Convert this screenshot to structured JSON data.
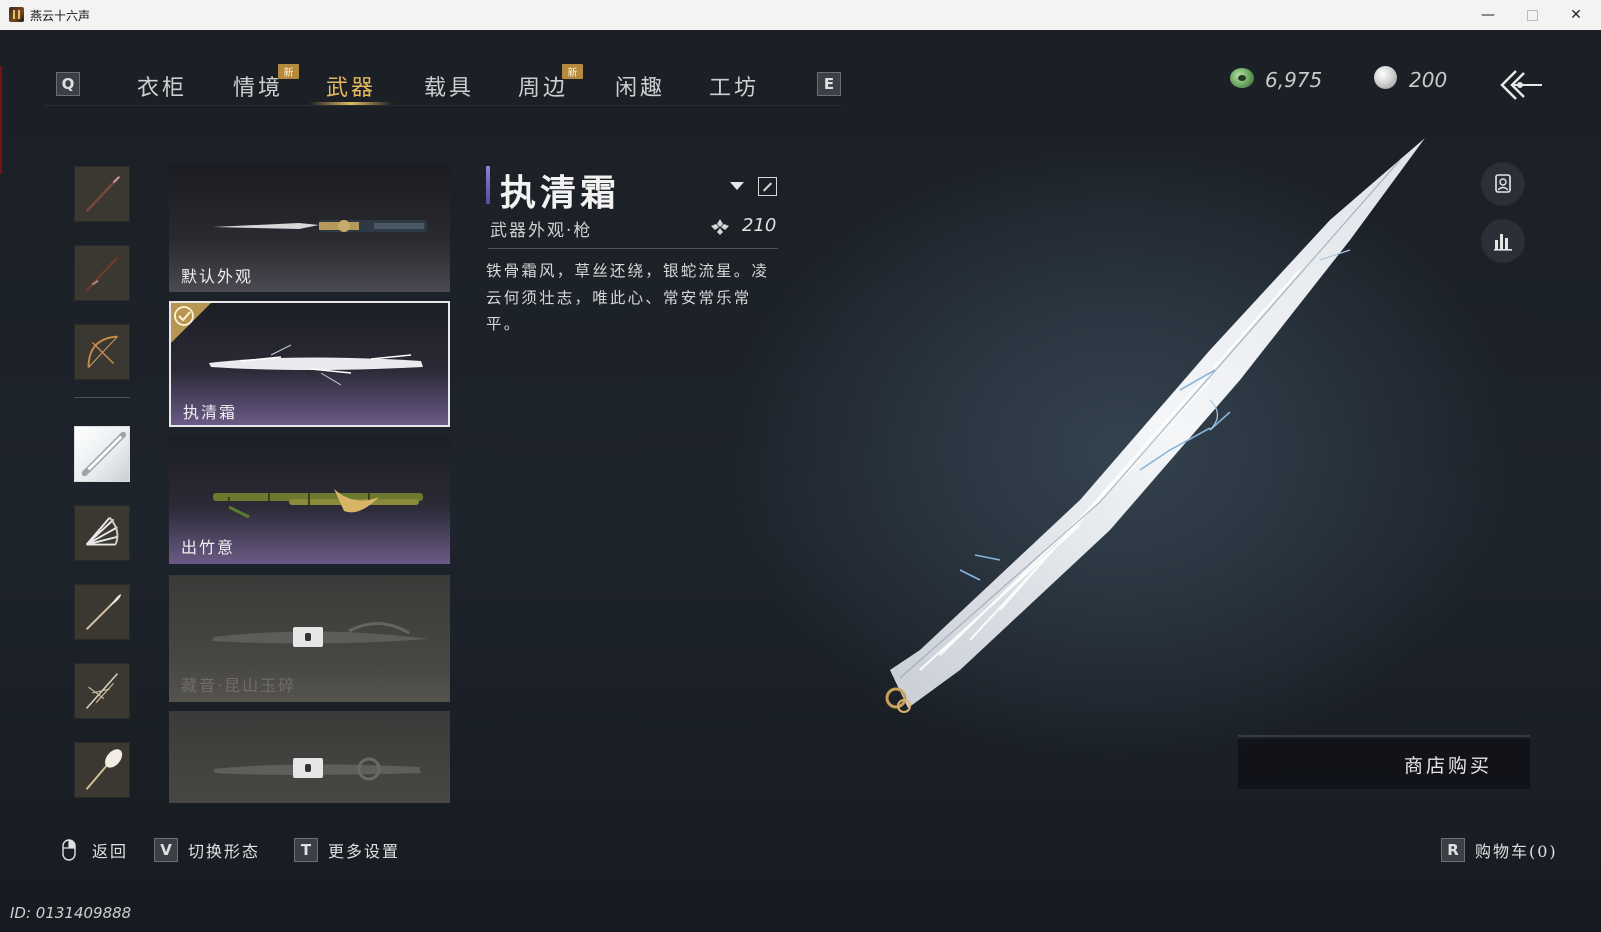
{
  "window": {
    "title": "燕云十六声"
  },
  "tabs": {
    "prev_key": "Q",
    "next_key": "E",
    "new_badge": "新",
    "items": [
      {
        "label": "衣柜",
        "active": false,
        "new": false
      },
      {
        "label": "情境",
        "active": false,
        "new": true
      },
      {
        "label": "武器",
        "active": true,
        "new": false
      },
      {
        "label": "载具",
        "active": false,
        "new": false
      },
      {
        "label": "周边",
        "active": false,
        "new": true
      },
      {
        "label": "闲趣",
        "active": false,
        "new": false
      },
      {
        "label": "工坊",
        "active": false,
        "new": false
      }
    ]
  },
  "currency": {
    "jade": "6,975",
    "pearl": "200"
  },
  "category_icons": [
    {
      "name": "spear-icon-1",
      "selected": false
    },
    {
      "name": "spear-icon-2",
      "selected": false
    },
    {
      "name": "bow-icon",
      "selected": false
    },
    {
      "name": "white-spear-icon",
      "selected": true
    },
    {
      "name": "fan-icon",
      "selected": false
    },
    {
      "name": "brush-icon",
      "selected": false
    },
    {
      "name": "umbrella-frame-icon",
      "selected": false
    },
    {
      "name": "whisk-icon",
      "selected": false
    }
  ],
  "weapon_cards": [
    {
      "label": "默认外观",
      "selected": false,
      "locked": false
    },
    {
      "label": "执清霜",
      "selected": true,
      "locked": false
    },
    {
      "label": "出竹意",
      "selected": false,
      "locked": false
    },
    {
      "label": "藏音·昆山玉碎",
      "selected": false,
      "locked": true
    },
    {
      "label": "",
      "selected": false,
      "locked": true
    }
  ],
  "detail": {
    "title": "执清霜",
    "subtitle": "武器外观·枪",
    "price": "210",
    "description": "铁骨霜风，草丝还绕，银蛇流星。凌云何须壮志，唯此心、常安常乐常平。"
  },
  "shop": {
    "buy_label": "商店购买"
  },
  "hints": {
    "back": {
      "label": "返回"
    },
    "switch": {
      "key": "V",
      "label": "切换形态"
    },
    "settings": {
      "key": "T",
      "label": "更多设置"
    },
    "cart": {
      "key": "R",
      "label": "购物车(0)"
    }
  },
  "player_id": "ID: 0131409888",
  "colors": {
    "accent_gold": "#e5b85f",
    "accent_purple": "#8d7fd2",
    "badge": "#b58a3f"
  }
}
